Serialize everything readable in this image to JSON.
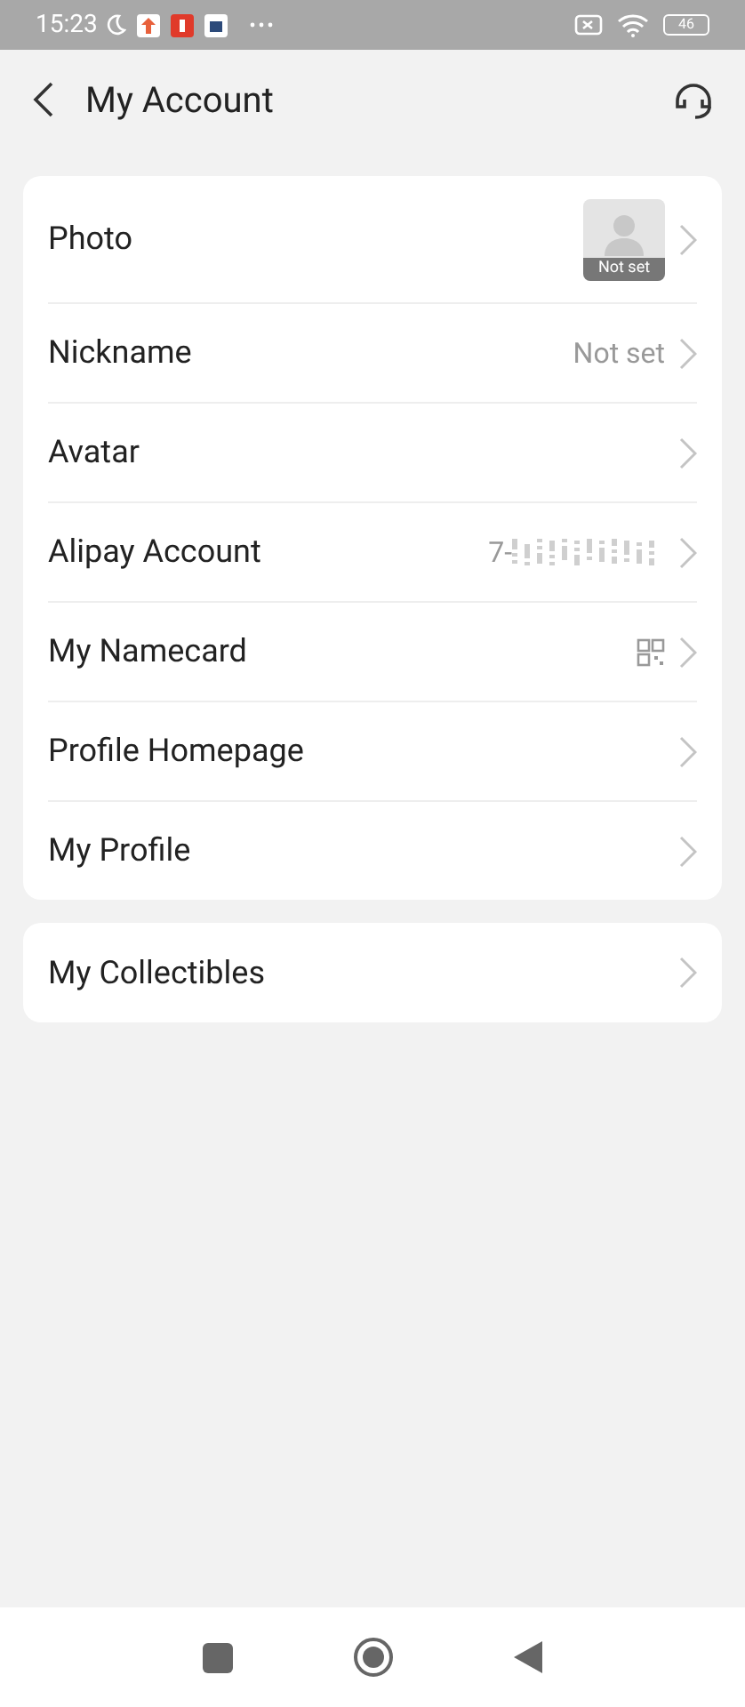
{
  "status_bar": {
    "time": "15:23",
    "battery": "46"
  },
  "header": {
    "title": "My Account"
  },
  "groups": [
    {
      "rows": [
        {
          "kind": "photo",
          "label": "Photo",
          "badge": "Not set"
        },
        {
          "kind": "value",
          "label": "Nickname",
          "value": "Not set"
        },
        {
          "kind": "plain",
          "label": "Avatar"
        },
        {
          "kind": "masked",
          "label": "Alipay Account",
          "value": "7-"
        },
        {
          "kind": "qr",
          "label": "My Namecard"
        },
        {
          "kind": "plain",
          "label": "Profile Homepage"
        },
        {
          "kind": "plain",
          "label": "My Profile"
        }
      ]
    },
    {
      "rows": [
        {
          "kind": "plain",
          "label": "My Collectibles"
        }
      ]
    }
  ]
}
